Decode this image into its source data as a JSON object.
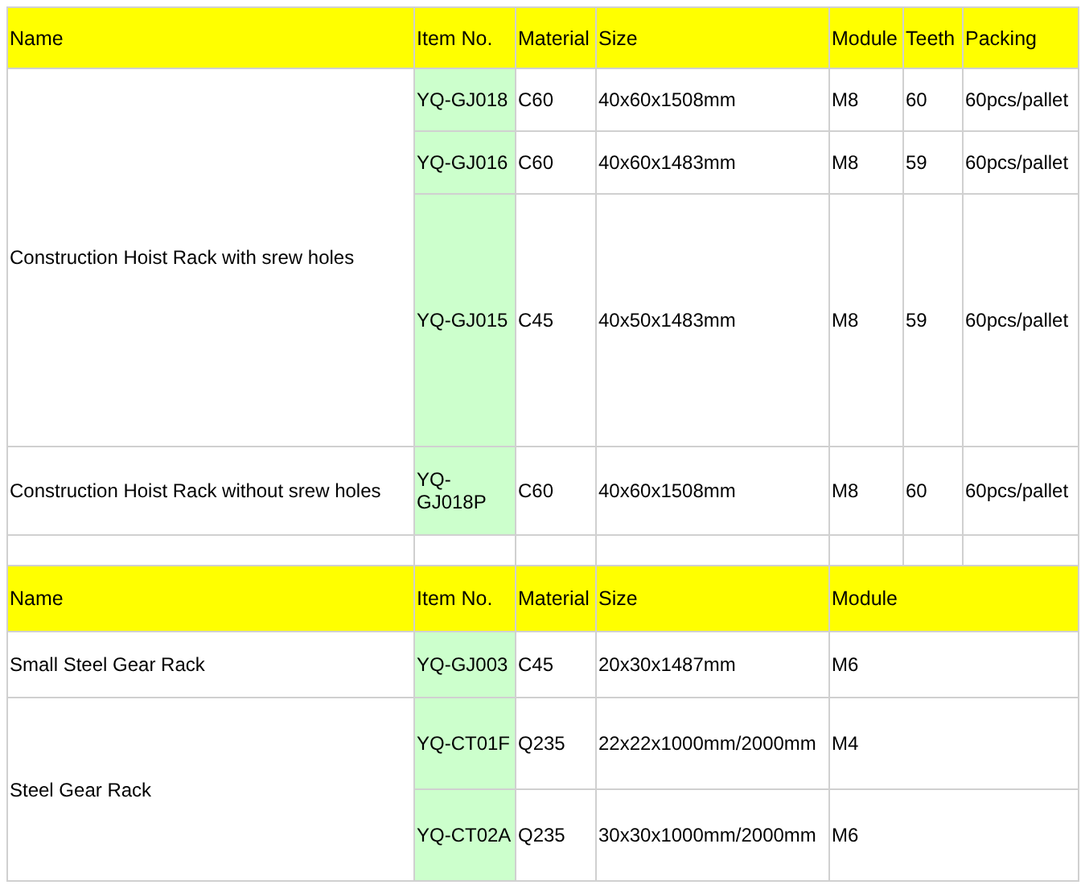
{
  "sections": [
    {
      "columns": [
        "Name",
        "Item No.",
        "Material",
        "Size",
        "Module",
        "Teeth",
        "Packing"
      ],
      "groups": [
        {
          "name": "Construction Hoist Rack with srew holes",
          "items": [
            {
              "item_no": "YQ-GJ018",
              "cells": [
                "C60",
                "40x60x1508mm",
                "M8",
                "60",
                "60pcs/pallet"
              ]
            },
            {
              "item_no": "YQ-GJ016",
              "cells": [
                "C60",
                "40x60x1483mm",
                "M8",
                "59",
                "60pcs/pallet"
              ]
            },
            {
              "item_no": "YQ-GJ015",
              "cells": [
                "C45",
                "40x50x1483mm",
                "M8",
                "59",
                "60pcs/pallet"
              ]
            }
          ]
        },
        {
          "name": "Construction Hoist Rack without srew holes",
          "items": [
            {
              "item_no": "YQ-GJ018P",
              "cells": [
                "C60",
                "40x60x1508mm",
                "M8",
                "60",
                "60pcs/pallet"
              ]
            }
          ]
        }
      ]
    },
    {
      "columns": [
        "Name",
        "Item No.",
        "Material",
        "Size",
        "Module"
      ],
      "groups": [
        {
          "name": "Small Steel Gear Rack",
          "items": [
            {
              "item_no": "YQ-GJ003",
              "cells": [
                "C45",
                "20x30x1487mm",
                "M6"
              ]
            }
          ]
        },
        {
          "name": "Steel Gear Rack",
          "items": [
            {
              "item_no": "YQ-CT01F",
              "cells": [
                "Q235",
                "22x22x1000mm/2000mm",
                "M4"
              ]
            },
            {
              "item_no": "YQ-CT02A",
              "cells": [
                "Q235",
                "30x30x1000mm/2000mm",
                "M6"
              ]
            }
          ]
        }
      ]
    }
  ]
}
